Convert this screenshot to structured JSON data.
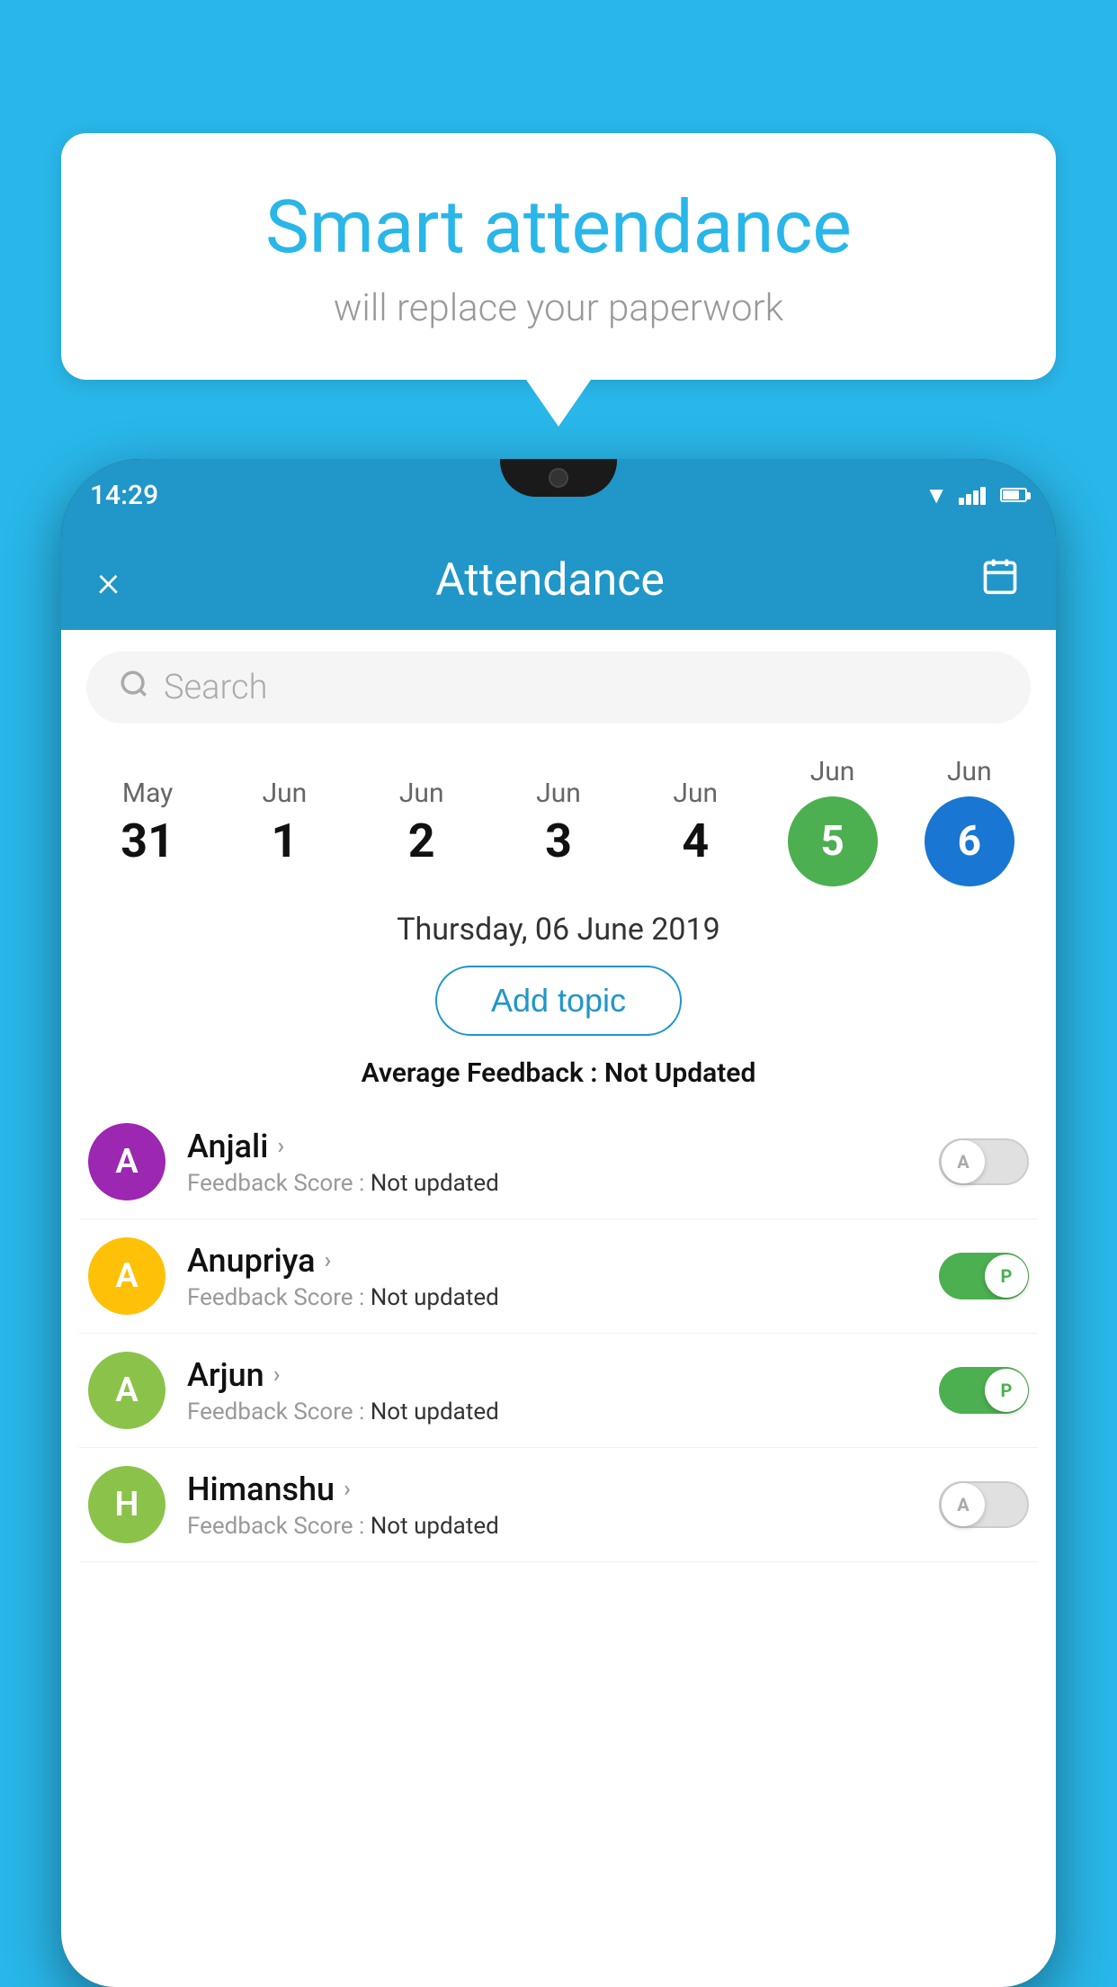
{
  "background_color": "#29b6e8",
  "speech_bubble": {
    "title": "Smart attendance",
    "subtitle": "will replace your paperwork"
  },
  "phone": {
    "status_bar": {
      "time": "14:29"
    },
    "header": {
      "close_label": "×",
      "title": "Attendance",
      "calendar_icon": "calendar-icon"
    },
    "search": {
      "placeholder": "Search"
    },
    "dates": [
      {
        "month": "May",
        "day": "31",
        "highlighted": false
      },
      {
        "month": "Jun",
        "day": "1",
        "highlighted": false
      },
      {
        "month": "Jun",
        "day": "2",
        "highlighted": false
      },
      {
        "month": "Jun",
        "day": "3",
        "highlighted": false
      },
      {
        "month": "Jun",
        "day": "4",
        "highlighted": false
      },
      {
        "month": "Jun",
        "day": "5",
        "highlighted": "green"
      },
      {
        "month": "Jun",
        "day": "6",
        "highlighted": "blue"
      }
    ],
    "selected_date": "Thursday, 06 June 2019",
    "add_topic_label": "Add topic",
    "avg_feedback_label": "Average Feedback :",
    "avg_feedback_value": "Not Updated",
    "students": [
      {
        "name": "Anjali",
        "avatar_letter": "A",
        "avatar_color": "#9c27b0",
        "feedback_label": "Feedback Score :",
        "feedback_value": "Not updated",
        "toggle": "off",
        "toggle_letter": "A"
      },
      {
        "name": "Anupriya",
        "avatar_letter": "A",
        "avatar_color": "#ffc107",
        "feedback_label": "Feedback Score :",
        "feedback_value": "Not updated",
        "toggle": "on",
        "toggle_letter": "P"
      },
      {
        "name": "Arjun",
        "avatar_letter": "A",
        "avatar_color": "#8bc34a",
        "feedback_label": "Feedback Score :",
        "feedback_value": "Not updated",
        "toggle": "on",
        "toggle_letter": "P"
      },
      {
        "name": "Himanshu",
        "avatar_letter": "H",
        "avatar_color": "#8bc34a",
        "feedback_label": "Feedback Score :",
        "feedback_value": "Not updated",
        "toggle": "off",
        "toggle_letter": "A"
      }
    ]
  }
}
